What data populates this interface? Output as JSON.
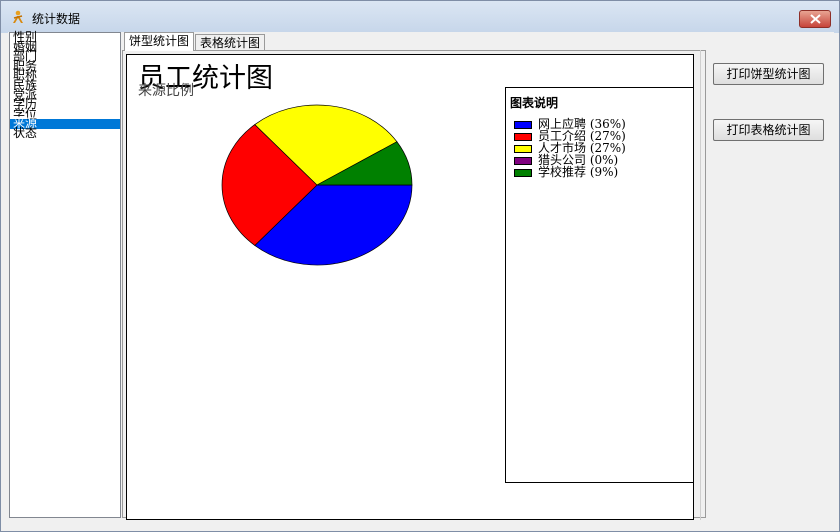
{
  "window": {
    "title": "统计数据"
  },
  "categories": {
    "items": [
      "性别",
      "婚姻",
      "部门",
      "职务",
      "职称",
      "民族",
      "党派",
      "学历",
      "学位",
      "来源",
      "状态"
    ],
    "selected": 9
  },
  "tabs": [
    {
      "label": "饼型统计图",
      "active": true
    },
    {
      "label": "表格统计图",
      "active": false
    }
  ],
  "chart": {
    "title": "员工统计图",
    "subtitle": "来源比例",
    "legend_title": "图表说明"
  },
  "chart_data": {
    "type": "pie",
    "title": "员工统计图",
    "subtitle": "来源比例",
    "slices": [
      {
        "label": "网上应聘",
        "value": 36,
        "color": "#0000ff",
        "legend_text": "网上应聘 (36%)"
      },
      {
        "label": "员工介绍",
        "value": 27,
        "color": "#ff0000",
        "legend_text": "员工介绍 (27%)"
      },
      {
        "label": "人才市场",
        "value": 27,
        "color": "#ffff00",
        "legend_text": "人才市场 (27%)"
      },
      {
        "label": "猎头公司",
        "value": 0,
        "color": "#800080",
        "legend_text": "猎头公司 (0%)"
      },
      {
        "label": "学校推荐",
        "value": 9,
        "color": "#008000",
        "legend_text": "学校推荐 (9%)"
      }
    ],
    "legend_position": "right"
  },
  "buttons": {
    "print_pie": "打印饼型统计图",
    "print_table": "打印表格统计图"
  },
  "icons": {
    "app": "app-person-icon",
    "close": "close-icon"
  }
}
